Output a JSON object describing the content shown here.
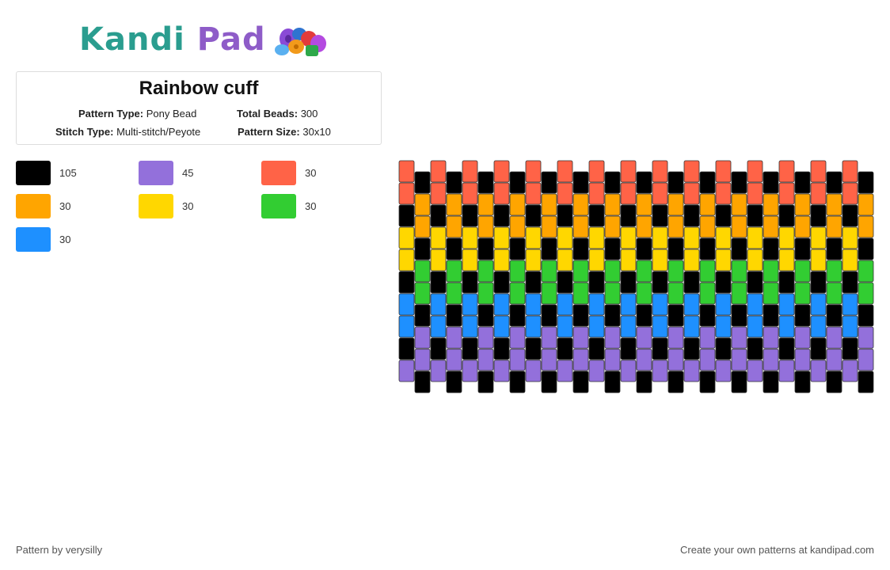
{
  "brand": {
    "part1": "Kandi",
    "part2": "Pad"
  },
  "pattern": {
    "title": "Rainbow cuff",
    "type_label": "Pattern Type:",
    "type_value": "Pony Bead",
    "beads_label": "Total Beads:",
    "beads_value": "300",
    "stitch_label": "Stitch Type:",
    "stitch_value": "Multi-stitch/Peyote",
    "size_label": "Pattern Size:",
    "size_value": "30x10"
  },
  "legend": [
    {
      "color": "#000000",
      "count": "105"
    },
    {
      "color": "#9370db",
      "count": "45"
    },
    {
      "color": "#ff6347",
      "count": "30"
    },
    {
      "color": "#ffa500",
      "count": "30"
    },
    {
      "color": "#ffd700",
      "count": "30"
    },
    {
      "color": "#32cd32",
      "count": "30"
    },
    {
      "color": "#1e90ff",
      "count": "30"
    }
  ],
  "palette": {
    "K": "#000000",
    "P": "#9370db",
    "R": "#ff6347",
    "O": "#ffa500",
    "Y": "#ffd700",
    "G": "#32cd32",
    "B": "#1e90ff"
  },
  "bead_grid": {
    "columns": 30,
    "rows_per_column": 10,
    "offset_columns": "odd",
    "even_column_colors": [
      "R",
      "R",
      "K",
      "Y",
      "Y",
      "K",
      "B",
      "B",
      "K",
      "P"
    ],
    "odd_column_colors": [
      "K",
      "O",
      "O",
      "K",
      "G",
      "G",
      "K",
      "P",
      "P",
      "K"
    ]
  },
  "footer": {
    "credit": "Pattern by verysilly",
    "cta": "Create your own patterns at kandipad.com"
  }
}
